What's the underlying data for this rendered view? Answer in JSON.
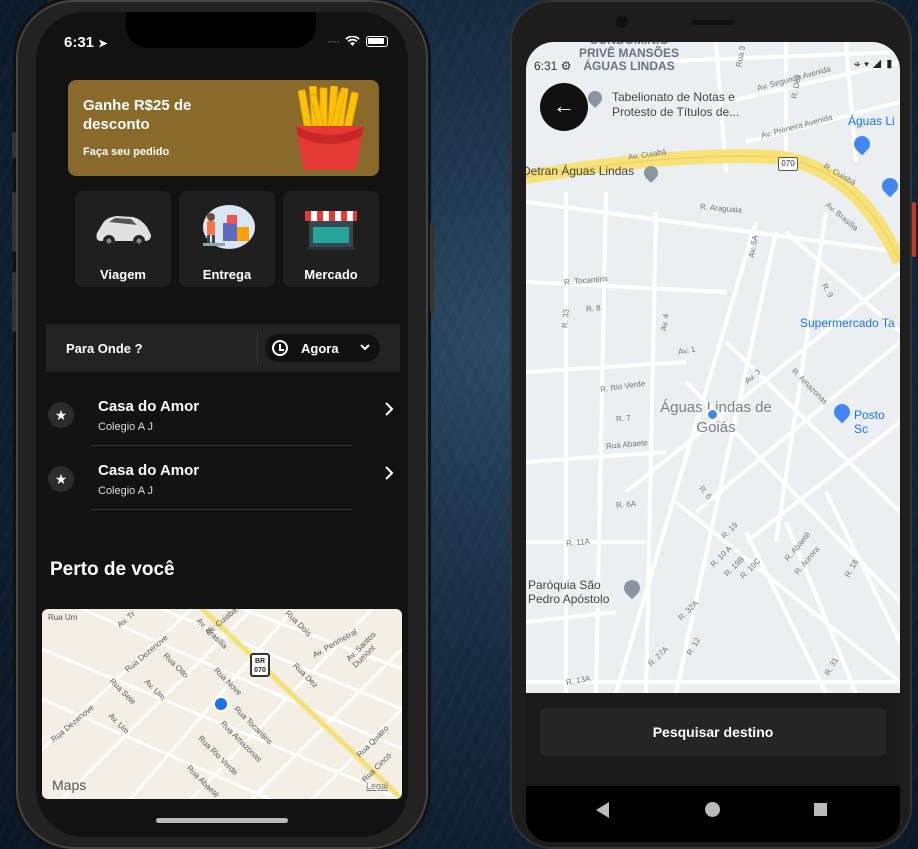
{
  "iphone": {
    "status": {
      "time": "6:31"
    },
    "promo": {
      "title": "Ganhe R$25 de desconto",
      "subtitle": "Faça seu pedido"
    },
    "services": [
      {
        "label": "Viagem",
        "icon": "car-icon"
      },
      {
        "label": "Entrega",
        "icon": "delivery-icon"
      },
      {
        "label": "Mercado",
        "icon": "store-icon"
      }
    ],
    "where": {
      "label": "Para Onde ?",
      "time_label": "Agora"
    },
    "favorites": [
      {
        "title": "Casa do Amor",
        "subtitle": "Colegio A J"
      },
      {
        "title": "Casa do Amor",
        "subtitle": "Colegio A J"
      }
    ],
    "nearby": {
      "title": "Perto de você"
    },
    "map": {
      "logo": "Maps",
      "legal": "Legal",
      "shield": "BR 070",
      "streets": [
        "Av. Tr",
        "Av. Cuiabá",
        "Av. Brasília",
        "Rua Dois",
        "Av. Perimetral",
        "Av. Santos Dumont",
        "Rua Dezenove",
        "Rua Oito",
        "Av. Um",
        "Rua Nove",
        "Rua Sete",
        "Rua Dez",
        "Rua Tocantins",
        "Rua Amazonas",
        "Rua Rio Verde",
        "Rua Abaeté",
        "Rua Quatro",
        "Rua Cinco",
        "Av. Um",
        "Rua Dezenove",
        "Rua Um"
      ]
    }
  },
  "android": {
    "status": {
      "time": "6:31"
    },
    "map": {
      "places": [
        "CONDOMÍNIO PRIVÊ MANSÕES ÁGUAS LINDAS",
        "Tabelionato de Notas e Protesto de Títulos de...",
        "Detran Águas Lindas",
        "Águas Li",
        "Supermercado Ta",
        "Posto Sc",
        "Paróquia São Pedro Apóstolo",
        "Águas Lindas de Goiás"
      ],
      "streets": [
        "Av. Segunda Avenida",
        "Av. Primeira Avenida",
        "Av. Cuiabá",
        "R. Cuiabá",
        "Av. Brasília",
        "R. Araguaia",
        "Av. 5A",
        "R. Tocantins",
        "R. 8",
        "R. 33",
        "Av. 4",
        "Av. 1",
        "R. Rio Verde",
        "Av. 3",
        "R. Amazonas",
        "R. 7",
        "Rua Abaete",
        "R. 6",
        "R. 6A",
        "R. 19",
        "R. 11A",
        "R. 10 A",
        "R. 19B",
        "R. 19C",
        "R. Abaetê",
        "R. Aurora",
        "R. 18",
        "R. 32A",
        "R. 27A",
        "R. 12",
        "R. 13A",
        "R. 31",
        "Rua 3",
        "R. Dez",
        "R. 9"
      ],
      "shield": "070"
    },
    "search_button": "Pesquisar destino"
  },
  "colors": {
    "promo": "#8a6a2b",
    "app_bg": "#121212",
    "card_bg": "#1f1f1f",
    "location_dot": "#1a73e8"
  }
}
